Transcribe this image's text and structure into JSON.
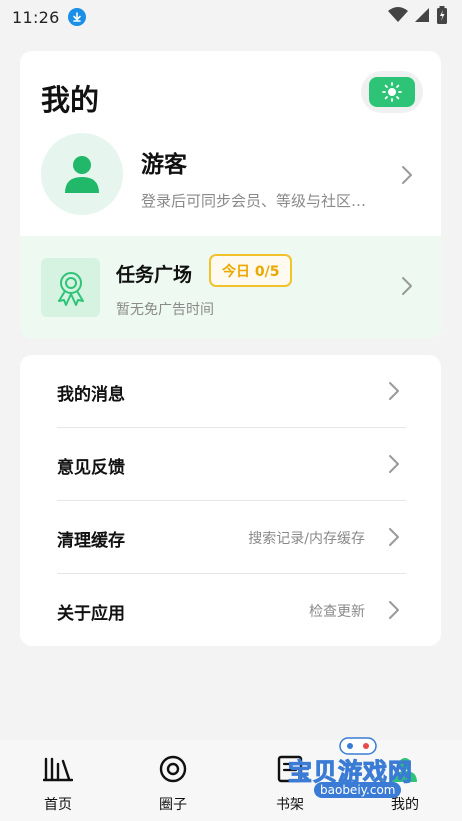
{
  "status_bar": {
    "time": "11:26"
  },
  "header": {
    "title": "我的"
  },
  "profile": {
    "name": "游客",
    "subtitle": "登录后可同步会员、等级与社区…"
  },
  "task": {
    "title": "任务广场",
    "badge": "今日 0/5",
    "subtitle": "暂无免广告时间"
  },
  "menu": [
    {
      "label": "我的消息",
      "value": ""
    },
    {
      "label": "意见反馈",
      "value": ""
    },
    {
      "label": "清理缓存",
      "value": "搜索记录/内存缓存"
    },
    {
      "label": "关于应用",
      "value": "检查更新"
    }
  ],
  "bottom_nav": [
    {
      "label": "首页",
      "icon": "bookshelf-columns-icon"
    },
    {
      "label": "圈子",
      "icon": "target-circle-icon"
    },
    {
      "label": "书架",
      "icon": "book-list-icon"
    },
    {
      "label": "我的",
      "icon": "person-icon"
    }
  ],
  "watermark": {
    "text": "宝贝游戏网",
    "url": "baobeiy.com"
  },
  "colors": {
    "accent": "#2ec477",
    "badge": "#f2c22a",
    "task_bg": "#eef9f2"
  }
}
